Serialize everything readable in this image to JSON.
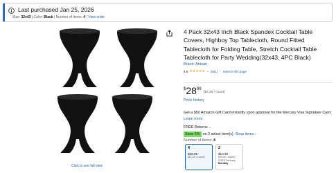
{
  "banner": {
    "title": "Last purchased Jan 25, 2026",
    "size_label": "Size: ",
    "size_value": "32x43",
    "color_label": " | Color: ",
    "color_value": "Black",
    "items_label": " | Number of Items: ",
    "items_value": "4",
    "separator": " | ",
    "view_order": "View order"
  },
  "gallery": {
    "image_alt": "4 Pack black spandex cocktail table covers",
    "full_view": "Click to see full view",
    "share_icon": "share-icon"
  },
  "product": {
    "title": "4 Pack 32x43 Inch Black Spandex Cocktail Table Covers, Highboy Top Tablecloth, Round Fitted Tablecloth for Folding Table, Stretch Cocktail Table Tablecloth for Party Wedding(32x43, 4PC Black)",
    "brand": "Brand: Antuan",
    "rating": "4.6",
    "stars": 4.6,
    "rating_count": "(551)",
    "search_page": "Search this page"
  },
  "price": {
    "symbol": "$",
    "whole": "28",
    "fraction": "99",
    "unit": "($7.25 / count)",
    "history": "Price history"
  },
  "gift": {
    "text": "Get a $50 Amazon Gift Card instantly upon approval for the Mercury Visa Signature Card. ",
    "link": "Learn more"
  },
  "returns": {
    "label": "FREE Returns",
    "chevron": "⌄"
  },
  "savings": {
    "badge": "Save 5%",
    "text": "on 2 select item(s)",
    "shop": "Shop items ›"
  },
  "items": {
    "label": "Number of Items: ",
    "value": "4"
  },
  "options": [
    {
      "count": "4",
      "price": "$28.99",
      "per_unit": "($7.25 / count)",
      "shipping": "",
      "shipping_day": ""
    },
    {
      "count": "2",
      "price": "$18.99",
      "per_unit": "($9.50 / count)",
      "shipping": "FREE Delivery",
      "shipping_day": "Monday"
    }
  ],
  "colors": {
    "link": "#2162a1",
    "accent_border": "#2b6fa8",
    "save_badge": "#7fda69",
    "star": "#f3a847"
  }
}
